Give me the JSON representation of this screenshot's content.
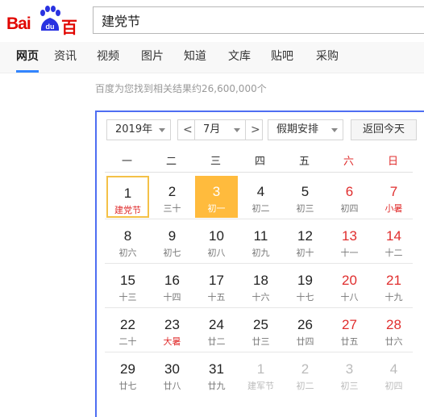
{
  "header": {
    "logo_bai": "Bai",
    "logo_du": "du",
    "logo_cn": "百度",
    "query": "建党节",
    "brand_color": "#e10601"
  },
  "tabs": [
    "网页",
    "资讯",
    "视频",
    "图片",
    "知道",
    "文库",
    "贴吧",
    "采购"
  ],
  "result_count": "百度为您找到相关结果约26,600,000个",
  "calendar": {
    "year": "2019年",
    "month": "7月",
    "prev": "<",
    "next": ">",
    "holiday": "假期安排",
    "today": "返回今天",
    "weekdays": [
      "一",
      "二",
      "三",
      "四",
      "五",
      "六",
      "日"
    ],
    "weeks": [
      [
        {
          "n": "1",
          "l": "建党节",
          "fest": true,
          "sel": true
        },
        {
          "n": "2",
          "l": "三十"
        },
        {
          "n": "3",
          "l": "初一",
          "today": true
        },
        {
          "n": "4",
          "l": "初二"
        },
        {
          "n": "5",
          "l": "初三"
        },
        {
          "n": "6",
          "l": "初四"
        },
        {
          "n": "7",
          "l": "小暑",
          "fest": true
        }
      ],
      [
        {
          "n": "8",
          "l": "初六"
        },
        {
          "n": "9",
          "l": "初七"
        },
        {
          "n": "10",
          "l": "初八"
        },
        {
          "n": "11",
          "l": "初九"
        },
        {
          "n": "12",
          "l": "初十"
        },
        {
          "n": "13",
          "l": "十一"
        },
        {
          "n": "14",
          "l": "十二"
        }
      ],
      [
        {
          "n": "15",
          "l": "十三"
        },
        {
          "n": "16",
          "l": "十四"
        },
        {
          "n": "17",
          "l": "十五"
        },
        {
          "n": "18",
          "l": "十六"
        },
        {
          "n": "19",
          "l": "十七"
        },
        {
          "n": "20",
          "l": "十八"
        },
        {
          "n": "21",
          "l": "十九"
        }
      ],
      [
        {
          "n": "22",
          "l": "二十"
        },
        {
          "n": "23",
          "l": "大暑",
          "fest": true
        },
        {
          "n": "24",
          "l": "廿二"
        },
        {
          "n": "25",
          "l": "廿三"
        },
        {
          "n": "26",
          "l": "廿四"
        },
        {
          "n": "27",
          "l": "廿五"
        },
        {
          "n": "28",
          "l": "廿六"
        }
      ],
      [
        {
          "n": "29",
          "l": "廿七"
        },
        {
          "n": "30",
          "l": "廿八"
        },
        {
          "n": "31",
          "l": "廿九"
        },
        {
          "n": "1",
          "l": "建军节",
          "other": true
        },
        {
          "n": "2",
          "l": "初二",
          "other": true
        },
        {
          "n": "3",
          "l": "初三",
          "other": true
        },
        {
          "n": "4",
          "l": "初四",
          "other": true
        }
      ]
    ]
  }
}
